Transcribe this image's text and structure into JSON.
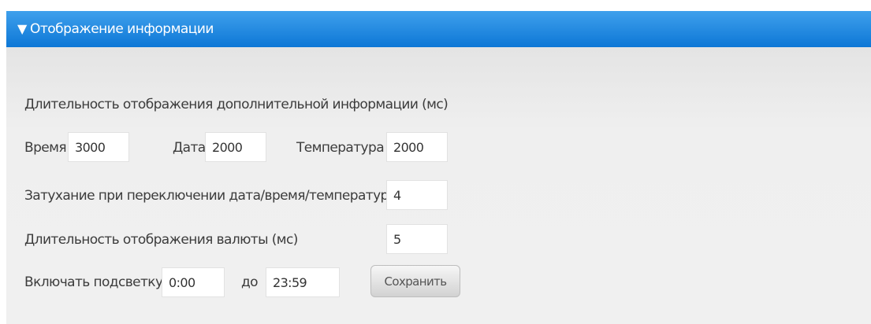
{
  "section": {
    "title": "Отображение информации"
  },
  "display_duration": {
    "heading": "Длительность отображения дополнительной информации (мс)",
    "time_label": "Время",
    "time_value": "3000",
    "date_label": "Дата",
    "date_value": "2000",
    "temperature_label": "Температура",
    "temperature_value": "2000"
  },
  "fade": {
    "label": "Затухание при переключении дата/время/температура (мс)",
    "value": "4"
  },
  "currency_duration": {
    "label": "Длительность отображения валюты (мс)",
    "value": "5"
  },
  "backlight": {
    "label": "Включать подсветку с",
    "from_value": "0:00",
    "to_label": "до",
    "to_value": "23:59"
  },
  "actions": {
    "save_label": "Сохранить"
  },
  "colors": {
    "header_top": "#3fa0ec",
    "header_bottom": "#0d77d6",
    "panel_bg": "#f0f0f0"
  }
}
